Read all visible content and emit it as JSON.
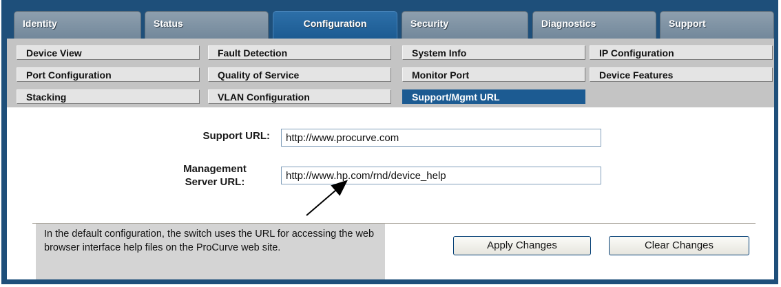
{
  "tabs": [
    {
      "label": "Identity",
      "active": false
    },
    {
      "label": "Status",
      "active": false
    },
    {
      "label": "Configuration",
      "active": true
    },
    {
      "label": "Security",
      "active": false
    },
    {
      "label": "Diagnostics",
      "active": false
    },
    {
      "label": "Support",
      "active": false
    }
  ],
  "subnav": [
    {
      "label": "Device View"
    },
    {
      "label": "Fault Detection"
    },
    {
      "label": "System Info"
    },
    {
      "label": "IP Configuration"
    },
    {
      "label": "Port Configuration"
    },
    {
      "label": "Quality of Service"
    },
    {
      "label": "Monitor Port"
    },
    {
      "label": "Device Features"
    },
    {
      "label": "Stacking"
    },
    {
      "label": "VLAN Configuration"
    },
    {
      "label": "Support/Mgmt URL",
      "active": true
    }
  ],
  "form": {
    "support_url_label": "Support URL:",
    "support_url_value": "http://www.procurve.com",
    "mgmt_label_line1": "Management",
    "mgmt_label_line2": "Server URL:",
    "mgmt_url_value": "http://www.hp.com/rnd/device_help"
  },
  "buttons": {
    "apply": "Apply Changes",
    "clear": "Clear Changes"
  },
  "callout": {
    "text": "In the default configuration, the switch uses the URL for accessing the web browser interface help files on the ProCurve web site."
  },
  "colors": {
    "frame_blue": "#1e4f7a",
    "active_tab": "#1c5b92",
    "subnav_bg": "#c4c4c4"
  }
}
